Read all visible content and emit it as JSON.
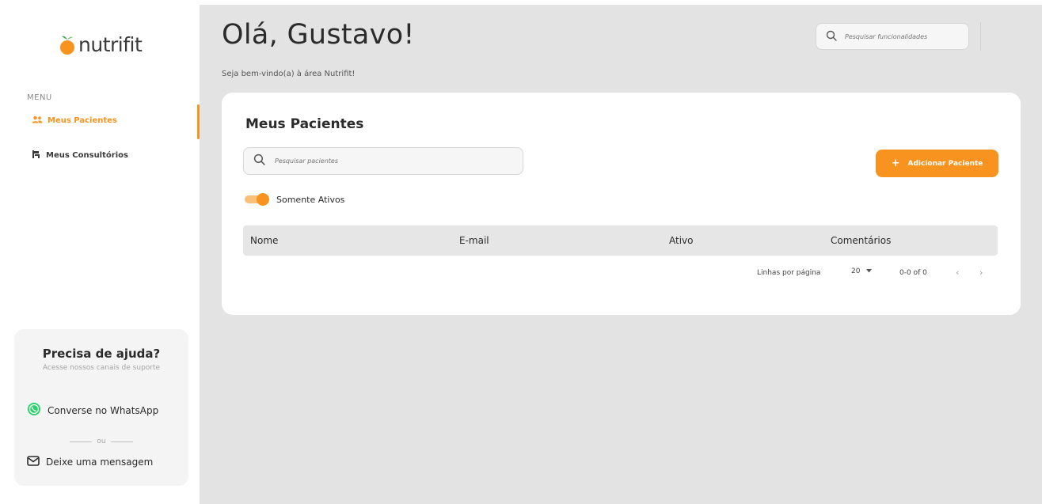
{
  "brand": {
    "name": "nutrifit",
    "accent": "#f7931e"
  },
  "sidebar": {
    "menu_label": "MENU",
    "items": [
      {
        "label": "Meus Pacientes",
        "icon": "users-icon",
        "active": true
      },
      {
        "label": "Meus Consultórios",
        "icon": "office-icon",
        "active": false
      }
    ]
  },
  "help": {
    "title": "Precisa de ajuda?",
    "subtitle": "Acesse nossos canais de suporte",
    "whatsapp_label": "Converse no WhatsApp",
    "or_label": "ou",
    "message_label": "Deixe uma mensagem"
  },
  "header": {
    "greeting": "Olá, Gustavo!",
    "welcome": "Seja bem-vindo(a) à área Nutrifit!",
    "search_placeholder": "Pesquisar funcionalidades"
  },
  "patients": {
    "title": "Meus Pacientes",
    "search_placeholder": "Pesquisar pacientes",
    "add_button": "Adicionar Paciente",
    "add_symbol": "+",
    "toggle_label": "Somente Ativos",
    "toggle_on": true,
    "columns": [
      "Nome",
      "E-mail",
      "Ativo",
      "Comentários"
    ],
    "rows": [],
    "pagination": {
      "rows_per_page_label": "Linhas por página",
      "rows_per_page": "20",
      "range": "0-0 of 0"
    }
  }
}
